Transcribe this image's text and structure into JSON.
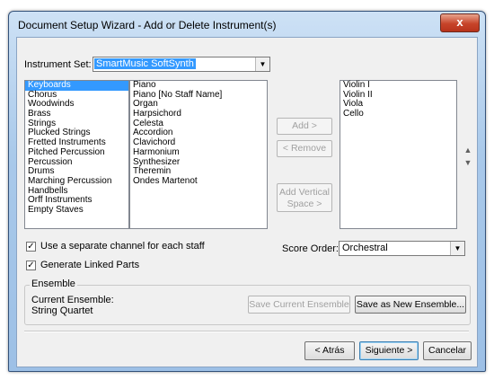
{
  "window": {
    "title": "Document Setup Wizard - Add or Delete Instrument(s)",
    "close_glyph": "x"
  },
  "instrument_set": {
    "label": "Instrument Set:",
    "value": "SmartMusic SoftSynth"
  },
  "families": [
    {
      "label": "Keyboards",
      "selected": true
    },
    {
      "label": "Chorus"
    },
    {
      "label": "Woodwinds"
    },
    {
      "label": "Brass"
    },
    {
      "label": "Strings"
    },
    {
      "label": "Plucked Strings"
    },
    {
      "label": "Fretted Instruments"
    },
    {
      "label": "Pitched Percussion"
    },
    {
      "label": "Percussion"
    },
    {
      "label": "Drums"
    },
    {
      "label": "Marching Percussion"
    },
    {
      "label": "Handbells"
    },
    {
      "label": "Orff Instruments"
    },
    {
      "label": "Empty Staves"
    }
  ],
  "instruments": [
    "Piano",
    "Piano [No Staff Name]",
    "Organ",
    "Harpsichord",
    "Celesta",
    "Accordion",
    "Clavichord",
    "Harmonium",
    "Synthesizer",
    "Theremin",
    "Ondes Martenot"
  ],
  "selected_instruments": [
    "Violin I",
    "Violin II",
    "Viola",
    "Cello"
  ],
  "buttons": {
    "add": "Add >",
    "remove": "< Remove",
    "add_vertical_space_1": "Add Vertical",
    "add_vertical_space_2": "Space >",
    "save_current": "Save Current Ensemble",
    "save_new": "Save as New Ensemble...",
    "back": "< Atrás",
    "next": "Siguiente >",
    "cancel": "Cancelar"
  },
  "options": {
    "separate_channel": "Use a separate channel for each staff",
    "linked_parts": "Generate Linked Parts"
  },
  "score_order": {
    "label": "Score Order:",
    "value": "Orchestral"
  },
  "ensemble": {
    "group_label": "Ensemble",
    "current_label": "Current Ensemble:",
    "current_value": "String Quartet"
  },
  "colors": {
    "selection": "#3399ff",
    "close_button": "#c7442a"
  }
}
